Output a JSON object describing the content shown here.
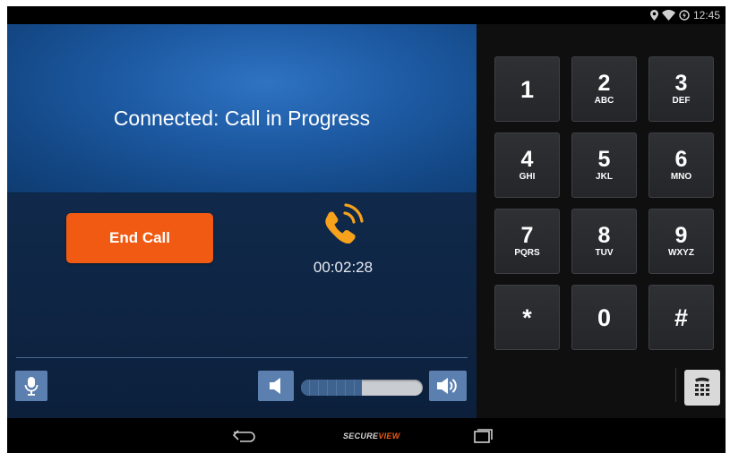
{
  "status_bar": {
    "time": "12:45",
    "icons": [
      "location-icon",
      "wifi-icon",
      "data-saver-icon"
    ]
  },
  "call": {
    "status_text": "Connected: Call in Progress",
    "end_call_label": "End Call",
    "timer": "00:02:28",
    "call_icon": "phone-ringing-icon",
    "volume_level": 0.5
  },
  "controls": {
    "mic_icon": "microphone-icon",
    "volume_down_icon": "speaker-low-icon",
    "volume_up_icon": "speaker-high-icon",
    "dialpad_icon": "dialpad-icon"
  },
  "keypad": {
    "keys": [
      {
        "digit": "1",
        "letters": ""
      },
      {
        "digit": "2",
        "letters": "ABC"
      },
      {
        "digit": "3",
        "letters": "DEF"
      },
      {
        "digit": "4",
        "letters": "GHI"
      },
      {
        "digit": "5",
        "letters": "JKL"
      },
      {
        "digit": "6",
        "letters": "MNO"
      },
      {
        "digit": "7",
        "letters": "PQRS"
      },
      {
        "digit": "8",
        "letters": "TUV"
      },
      {
        "digit": "9",
        "letters": "WXYZ"
      },
      {
        "digit": "*",
        "letters": ""
      },
      {
        "digit": "0",
        "letters": ""
      },
      {
        "digit": "#",
        "letters": ""
      }
    ]
  },
  "nav": {
    "brand_main": "SECURE",
    "brand_accent": "VIEW"
  },
  "colors": {
    "accent": "#f05a12",
    "banner_blue": "#1d5aa3",
    "panel_dark": "#10294a",
    "key_bg": "#2f3034"
  }
}
